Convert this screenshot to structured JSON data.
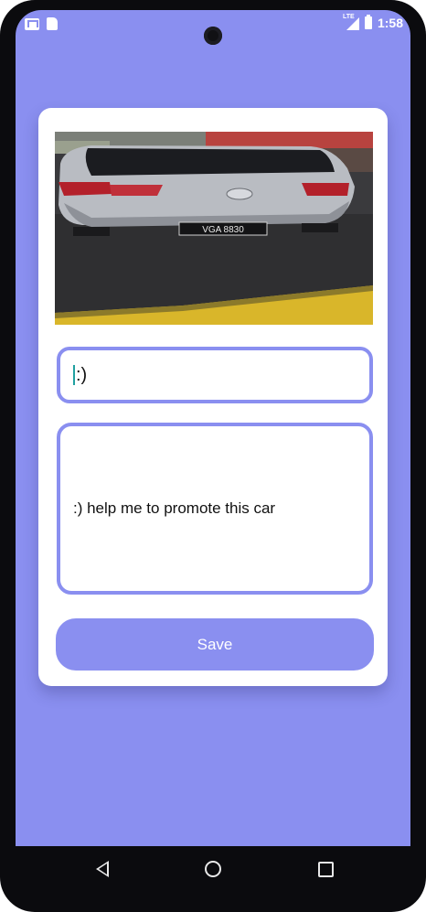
{
  "status_bar": {
    "time": "1:58",
    "network_label": "LTE",
    "icons": [
      "gmail-icon",
      "sd-card-icon",
      "lte-signal-icon",
      "battery-icon"
    ]
  },
  "card": {
    "photo_alt_icon": "car-photo",
    "plate_text": "VGA 8830",
    "title_value": ":)",
    "description_value": ":) help me to promote this car",
    "save_label": "Save"
  },
  "nav": {
    "icons": [
      "back-icon",
      "home-icon",
      "recents-icon"
    ]
  },
  "colors": {
    "accent": "#8a8ff0",
    "card": "#ffffff",
    "frame": "#0b0b0e"
  }
}
